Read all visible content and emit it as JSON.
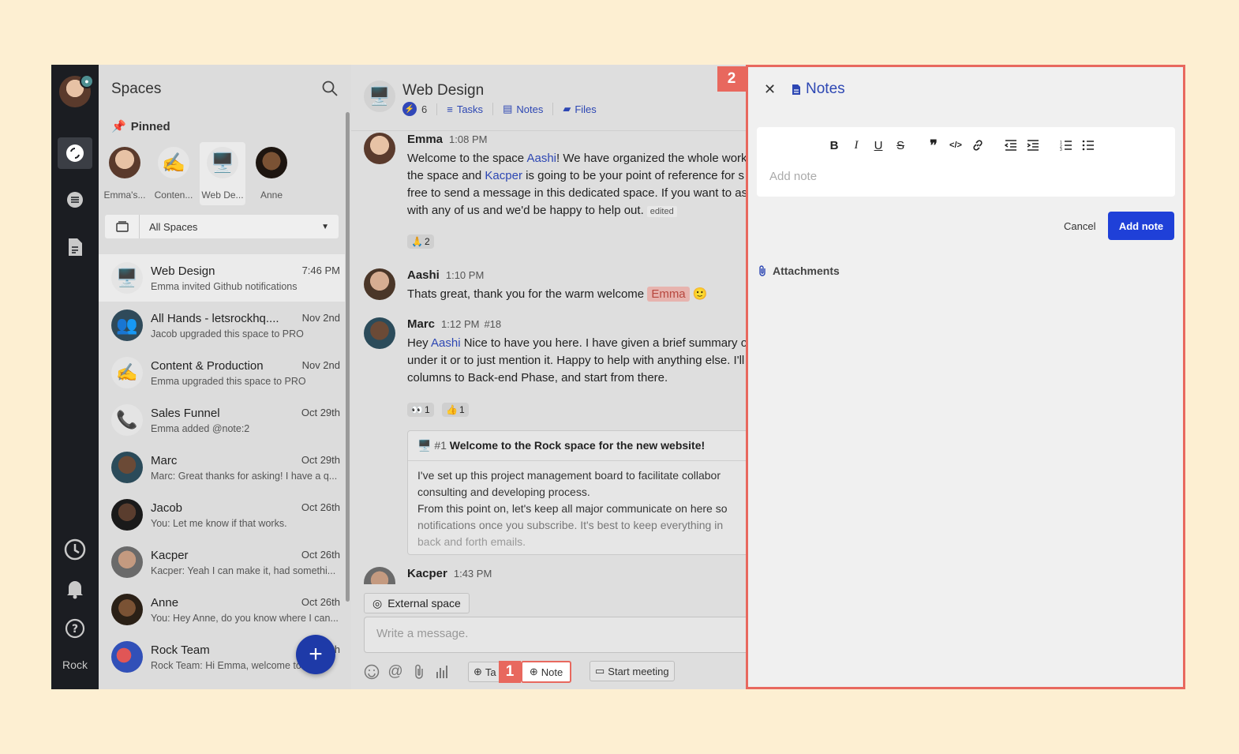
{
  "rail": {
    "brand": "Rock"
  },
  "spaces": {
    "title": "Spaces",
    "pinned_title": "Pinned",
    "pinned": [
      {
        "label": "Emma's...",
        "icon": "avatar"
      },
      {
        "label": "Conten...",
        "icon": "✍️"
      },
      {
        "label": "Web De...",
        "icon": "🖥️"
      },
      {
        "label": "Anne",
        "icon": "avatar"
      }
    ],
    "filter": "All Spaces",
    "items": [
      {
        "name": "Web Design",
        "time": "7:46 PM",
        "sub": "Emma invited Github notifications",
        "icon": "🖥️"
      },
      {
        "name": "All Hands - letsrockhq....",
        "time": "Nov 2nd",
        "sub": "Jacob upgraded this space to PRO",
        "icon": "👥"
      },
      {
        "name": "Content & Production",
        "time": "Nov 2nd",
        "sub": "Emma upgraded this space to PRO",
        "icon": "✍️"
      },
      {
        "name": "Sales Funnel",
        "time": "Oct 29th",
        "sub": "Emma added @note:2",
        "icon": "📞"
      },
      {
        "name": "Marc",
        "time": "Oct 29th",
        "sub": "Marc: Great thanks for asking! I have a q...",
        "icon": ""
      },
      {
        "name": "Jacob",
        "time": "Oct 26th",
        "sub": "You: Let me know if that works.",
        "icon": ""
      },
      {
        "name": "Kacper",
        "time": "Oct 26th",
        "sub": "Kacper: Yeah I can make it, had somethi...",
        "icon": ""
      },
      {
        "name": "Anne",
        "time": "Oct 26th",
        "sub": "You: Hey Anne, do you know where I can...",
        "icon": ""
      },
      {
        "name": "Rock Team",
        "time": "th",
        "sub": "Rock Team: Hi Emma, welcome to ...",
        "icon": ""
      }
    ]
  },
  "chat": {
    "title": "Web Design",
    "member_count": "6",
    "tabs": [
      "Tasks",
      "Notes",
      "Files"
    ],
    "messages": {
      "emma": {
        "author": "Emma",
        "time": "1:08 PM",
        "l1a": "Welcome to the space ",
        "l1m": "Aashi",
        "l1b": "! We have organized the whole workfl",
        "l2a": "the space and ",
        "l2m": "Kacper",
        "l2b": "  is going to be your point of reference for s",
        "l3": "free to send a message in this dedicated space. If you want to as",
        "l4": "with any of us and we'd be happy to help out.",
        "edited": "edited",
        "reaction_emoji": "🙏",
        "reaction_count": "2"
      },
      "aashi": {
        "author": "Aashi",
        "time": "1:10 PM",
        "text": "Thats great, thank you for the warm welcome ",
        "tag": "Emma",
        "emoji": "🙂"
      },
      "marc": {
        "author": "Marc",
        "time": "1:12 PM",
        "ref": "#18",
        "l1a": "Hey ",
        "l1m": "Aashi",
        "l1b": " Nice to have you here. I have given a brief summary of",
        "l2": "under it or to just mention it. Happy to help with anything else. I'll",
        "l3": "columns to Back-end Phase, and start from there.",
        "r1_emoji": "👀",
        "r1_count": "1",
        "r2_emoji": "👍",
        "r2_count": "1",
        "card_num": "#1",
        "card_title": "Welcome to the Rock space for the new website!",
        "card_l1": "I've set up this project management board to facilitate collabor",
        "card_l2": "consulting and developing process.",
        "card_l3": "From this point on, let's keep all major communicate on here so",
        "card_l4": "notifications once you subscribe. It's best to keep everything in",
        "card_l5": "back and forth emails."
      },
      "kacper": {
        "author": "Kacper",
        "time": "1:43 PM"
      }
    },
    "external": "External space",
    "input_placeholder": "Write a message.",
    "btn_task": "Ta",
    "btn_note": "Note",
    "btn_meeting": "Start meeting"
  },
  "notes_panel": {
    "title": "Notes",
    "placeholder": "Add note",
    "cancel": "Cancel",
    "add": "Add note",
    "attachments": "Attachments"
  },
  "markers": {
    "one": "1",
    "two": "2"
  },
  "colors": {
    "accent": "#2d47b3",
    "primary_button": "#1f40d8",
    "highlight": "#e8685e",
    "background": "#fdefd2"
  }
}
